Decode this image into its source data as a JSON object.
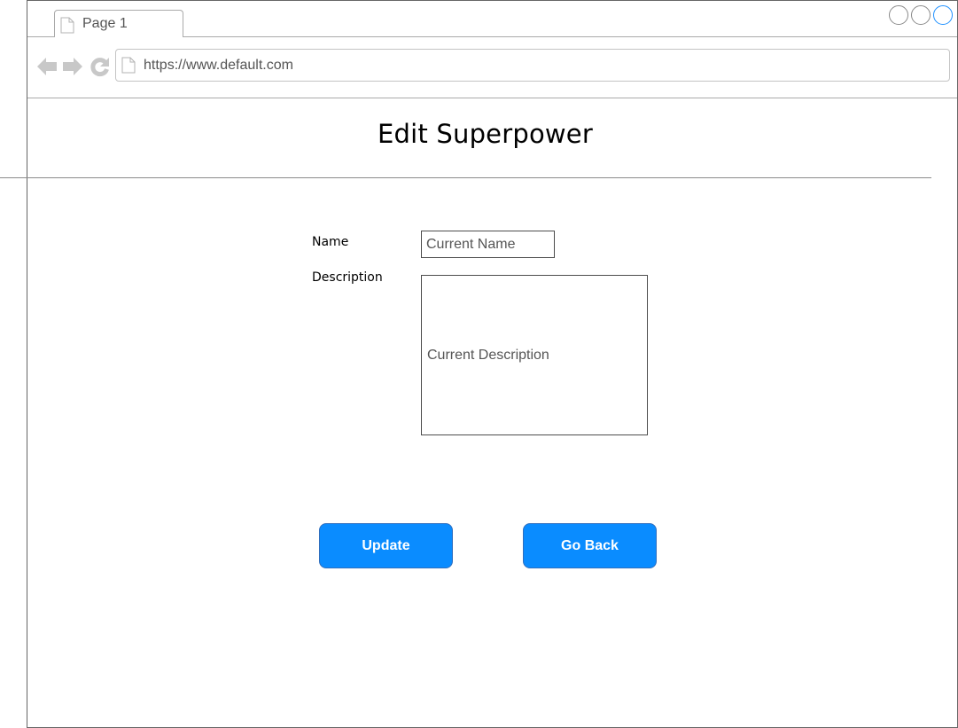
{
  "browser": {
    "tab": {
      "label": "Page 1",
      "icon": "page-icon"
    },
    "address_bar": {
      "url": "https://www.default.com",
      "icon": "page-icon"
    },
    "nav": {
      "back_icon": "arrow-left-icon",
      "forward_icon": "arrow-right-icon",
      "reload_icon": "reload-icon"
    },
    "window_controls": [
      "minimize",
      "restore",
      "maximize"
    ],
    "colors": {
      "control_border": "#8a8a8a",
      "control_active": "#1e90ff"
    }
  },
  "page": {
    "title": "Edit Superpower",
    "form": {
      "name_label": "Name",
      "name_value": "Current Name",
      "description_label": "Description",
      "description_value": "Current Description"
    },
    "buttons": {
      "update_label": "Update",
      "go_back_label": "Go Back"
    },
    "colors": {
      "button_bg": "#0a8cff",
      "button_text": "#ffffff"
    }
  }
}
